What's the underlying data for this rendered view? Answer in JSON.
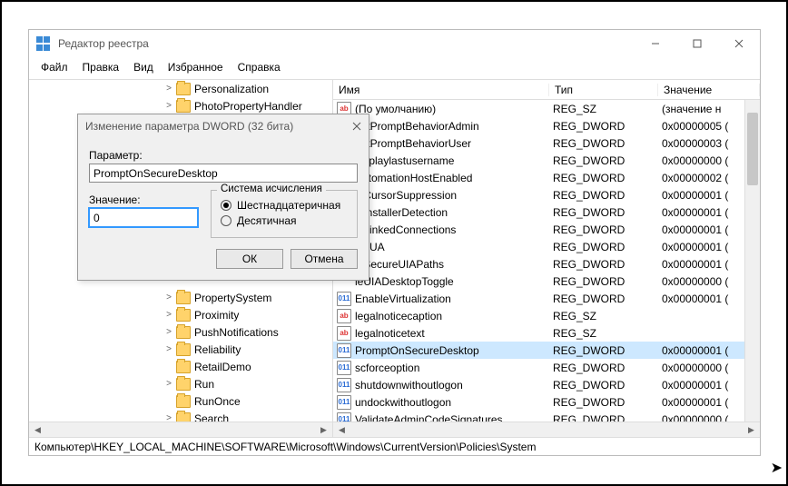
{
  "window": {
    "title": "Редактор реестра"
  },
  "menu": {
    "file": "Файл",
    "edit": "Правка",
    "view": "Вид",
    "fav": "Избранное",
    "help": "Справка"
  },
  "tree": {
    "items": [
      {
        "indent": 148,
        "twist": ">",
        "label": "Personalization"
      },
      {
        "indent": 148,
        "twist": ">",
        "label": "PhotoPropertyHandler"
      },
      {
        "indent": 148,
        "twist": ">",
        "label": "PropertySystem"
      },
      {
        "indent": 148,
        "twist": ">",
        "label": "Proximity"
      },
      {
        "indent": 148,
        "twist": ">",
        "label": "PushNotifications"
      },
      {
        "indent": 148,
        "twist": ">",
        "label": "Reliability"
      },
      {
        "indent": 148,
        "twist": "",
        "label": "RetailDemo"
      },
      {
        "indent": 148,
        "twist": ">",
        "label": "Run"
      },
      {
        "indent": 148,
        "twist": "",
        "label": "RunOnce"
      },
      {
        "indent": 148,
        "twist": ">",
        "label": "Search"
      }
    ]
  },
  "list": {
    "headers": {
      "name": "Имя",
      "type": "Тип",
      "value": "Значение"
    },
    "rows": [
      {
        "icon": "str",
        "name": "(По умолчанию)",
        "type": "REG_SZ",
        "value": "(значение н",
        "sel": false,
        "clip": false
      },
      {
        "icon": "bin",
        "name": "entPromptBehaviorAdmin",
        "type": "REG_DWORD",
        "value": "0x00000005 (",
        "sel": false,
        "clip": true
      },
      {
        "icon": "bin",
        "name": "entPromptBehaviorUser",
        "type": "REG_DWORD",
        "value": "0x00000003 (",
        "sel": false,
        "clip": true
      },
      {
        "icon": "bin",
        "name": "displaylastusername",
        "type": "REG_DWORD",
        "value": "0x00000000 (",
        "sel": false,
        "clip": true
      },
      {
        "icon": "bin",
        "name": "AutomationHostEnabled",
        "type": "REG_DWORD",
        "value": "0x00000002 (",
        "sel": false,
        "clip": true
      },
      {
        "icon": "bin",
        "name": "leCursorSuppression",
        "type": "REG_DWORD",
        "value": "0x00000001 (",
        "sel": false,
        "clip": true
      },
      {
        "icon": "bin",
        "name": "leInstallerDetection",
        "type": "REG_DWORD",
        "value": "0x00000001 (",
        "sel": false,
        "clip": true
      },
      {
        "icon": "bin",
        "name": "leLinkedConnections",
        "type": "REG_DWORD",
        "value": "0x00000001 (",
        "sel": false,
        "clip": true
      },
      {
        "icon": "bin",
        "name": "leLUA",
        "type": "REG_DWORD",
        "value": "0x00000001 (",
        "sel": false,
        "clip": true
      },
      {
        "icon": "bin",
        "name": "leSecureUIAPaths",
        "type": "REG_DWORD",
        "value": "0x00000001 (",
        "sel": false,
        "clip": true
      },
      {
        "icon": "bin",
        "name": "leUIADesktopToggle",
        "type": "REG_DWORD",
        "value": "0x00000000 (",
        "sel": false,
        "clip": true
      },
      {
        "icon": "bin",
        "name": "EnableVirtualization",
        "type": "REG_DWORD",
        "value": "0x00000001 (",
        "sel": false,
        "clip": false
      },
      {
        "icon": "str",
        "name": "legalnoticecaption",
        "type": "REG_SZ",
        "value": "",
        "sel": false,
        "clip": false
      },
      {
        "icon": "str",
        "name": "legalnoticetext",
        "type": "REG_SZ",
        "value": "",
        "sel": false,
        "clip": false
      },
      {
        "icon": "bin",
        "name": "PromptOnSecureDesktop",
        "type": "REG_DWORD",
        "value": "0x00000001 (",
        "sel": true,
        "clip": false
      },
      {
        "icon": "bin",
        "name": "scforceoption",
        "type": "REG_DWORD",
        "value": "0x00000000 (",
        "sel": false,
        "clip": false
      },
      {
        "icon": "bin",
        "name": "shutdownwithoutlogon",
        "type": "REG_DWORD",
        "value": "0x00000001 (",
        "sel": false,
        "clip": false
      },
      {
        "icon": "bin",
        "name": "undockwithoutlogon",
        "type": "REG_DWORD",
        "value": "0x00000001 (",
        "sel": false,
        "clip": false
      },
      {
        "icon": "bin",
        "name": "ValidateAdminCodeSignatures",
        "type": "REG_DWORD",
        "value": "0x00000000 (",
        "sel": false,
        "clip": false
      }
    ]
  },
  "status": "Компьютер\\HKEY_LOCAL_MACHINE\\SOFTWARE\\Microsoft\\Windows\\CurrentVersion\\Policies\\System",
  "dialog": {
    "title": "Изменение параметра DWORD (32 бита)",
    "param_label": "Параметр:",
    "param_value": "PromptOnSecureDesktop",
    "value_label": "Значение:",
    "value": "0",
    "group_label": "Система исчисления",
    "radio_hex": "Шестнадцатеричная",
    "radio_dec": "Десятичная",
    "ok": "ОК",
    "cancel": "Отмена"
  }
}
